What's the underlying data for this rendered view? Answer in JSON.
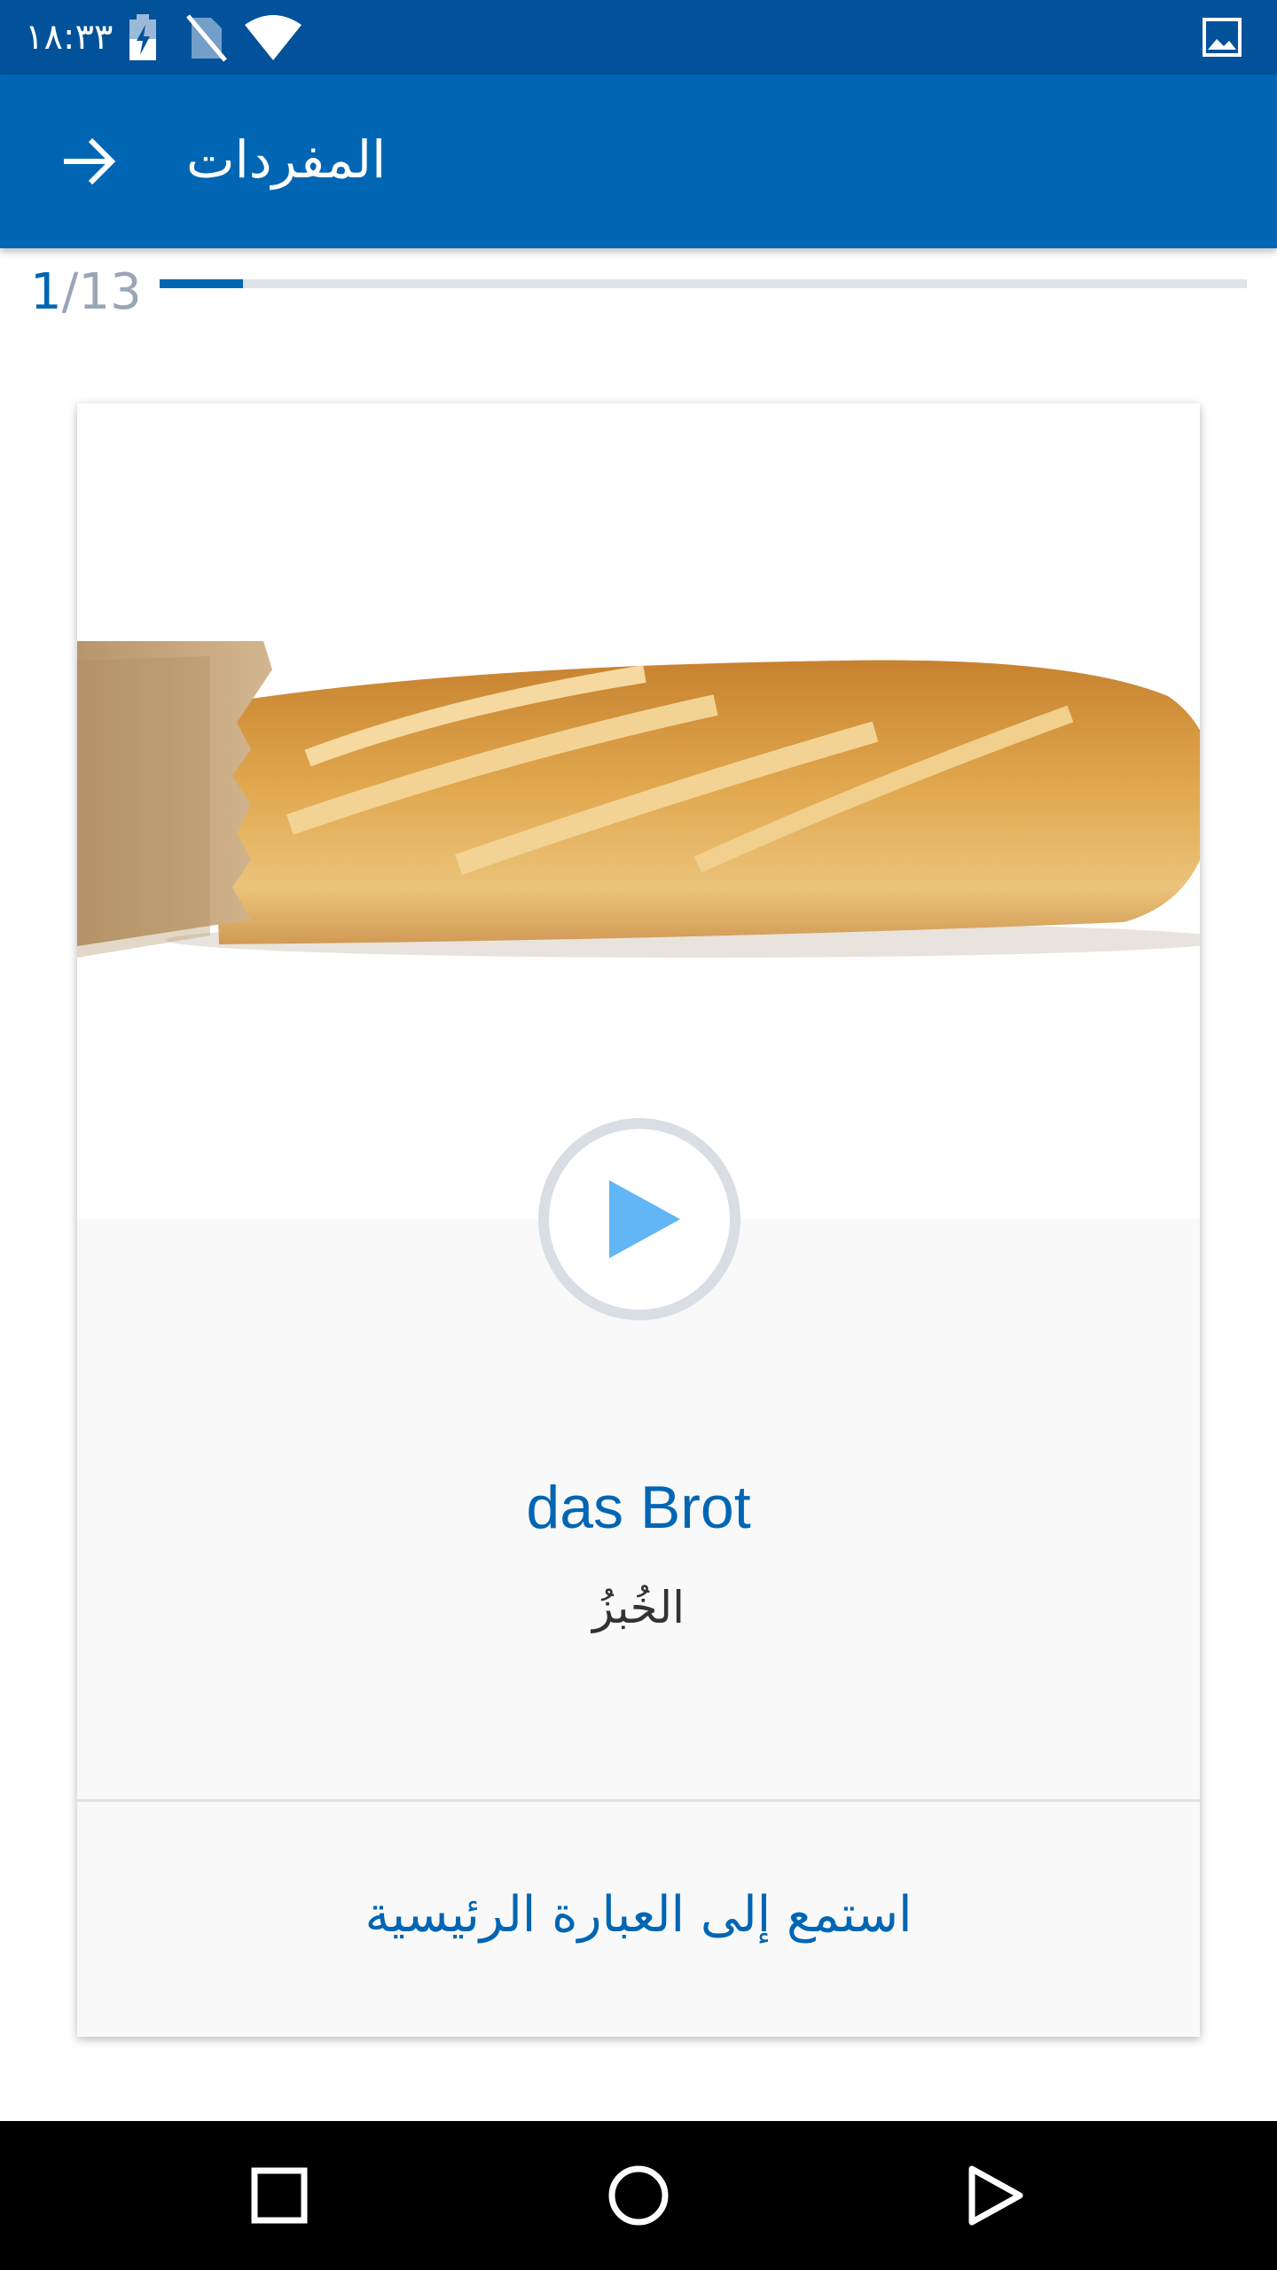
{
  "status_bar": {
    "time": "١٨:٣٣",
    "icons": [
      "battery-charging-icon",
      "no-sim-icon",
      "wifi-icon",
      "image-notification-icon"
    ]
  },
  "app_bar": {
    "back_icon": "arrow-back-icon",
    "title": "المفردات"
  },
  "progress": {
    "current": "1",
    "total": "/13",
    "fraction": 0.077
  },
  "card": {
    "image": "baguette-photo",
    "play_icon": "play-icon",
    "word": "das Brot",
    "translation": "الخُبزُ",
    "listen_label": "استمع إلى العبارة الرئيسية"
  },
  "nav_bar": {
    "icons": [
      "recents-icon",
      "home-icon",
      "back-triangle-icon"
    ]
  },
  "colors": {
    "status_bar": "#02519b",
    "app_bar": "#0066b3",
    "accent": "#0066b3",
    "play_triangle": "#62b6f5"
  }
}
